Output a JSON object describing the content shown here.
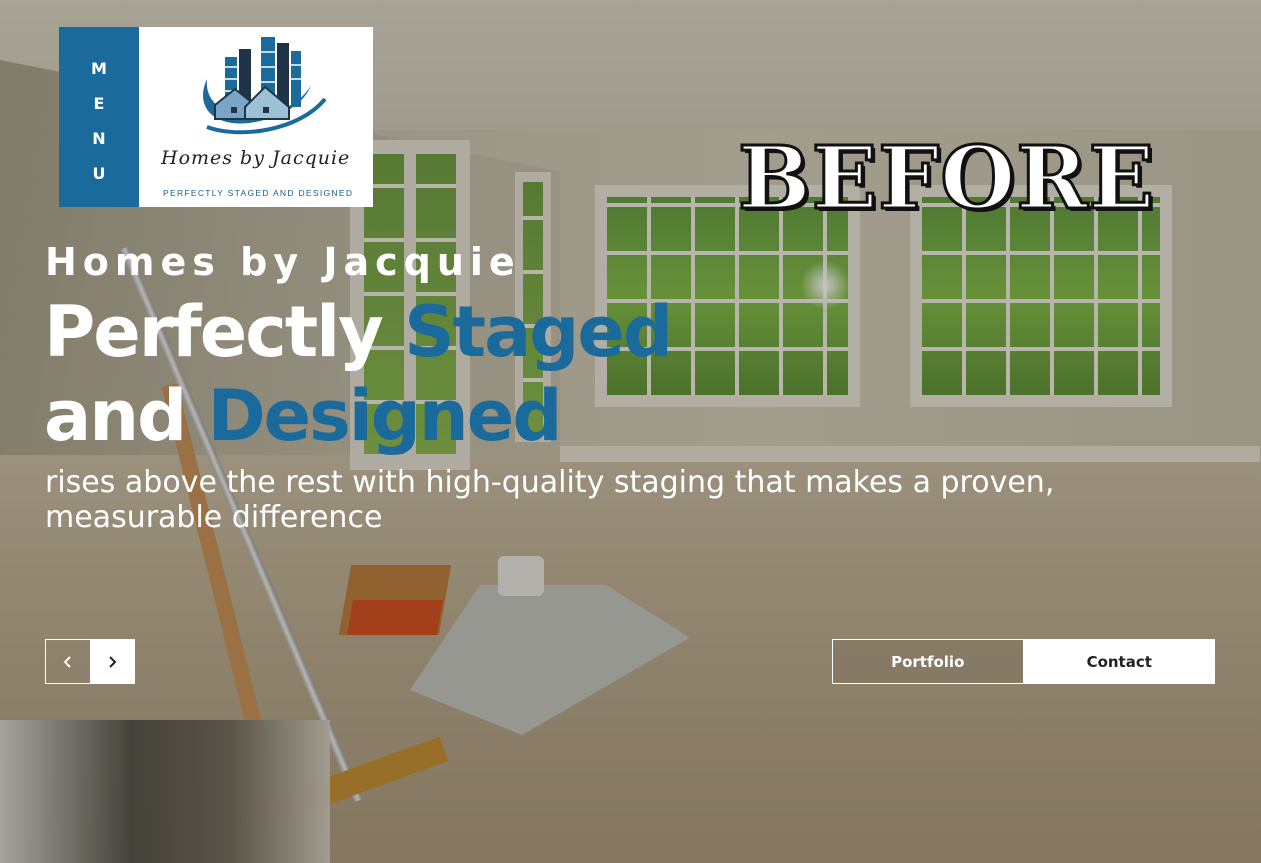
{
  "menu": {
    "letters": [
      "M",
      "E",
      "N",
      "U"
    ]
  },
  "logo": {
    "script_text": "Homes by Jacquie",
    "tagline": "PERFECTLY STAGED AND DESIGNED"
  },
  "overlay_label": "BEFORE",
  "hero": {
    "subtitle": "Homes by Jacquie",
    "title_line1_plain": "Perfectly",
    "title_line1_accent": "Staged",
    "title_line2_plain": "and",
    "title_line2_accent": "Designed",
    "description": "rises above the rest with high-quality staging that makes a proven, measurable difference"
  },
  "slider": {
    "prev_icon": "chevron-left-icon",
    "next_icon": "chevron-right-icon"
  },
  "buttons": {
    "portfolio": "Portfolio",
    "contact": "Contact"
  },
  "colors": {
    "accent": "#1a6b9c",
    "menu_bg": "#1a6b9c",
    "text": "#ffffff"
  }
}
